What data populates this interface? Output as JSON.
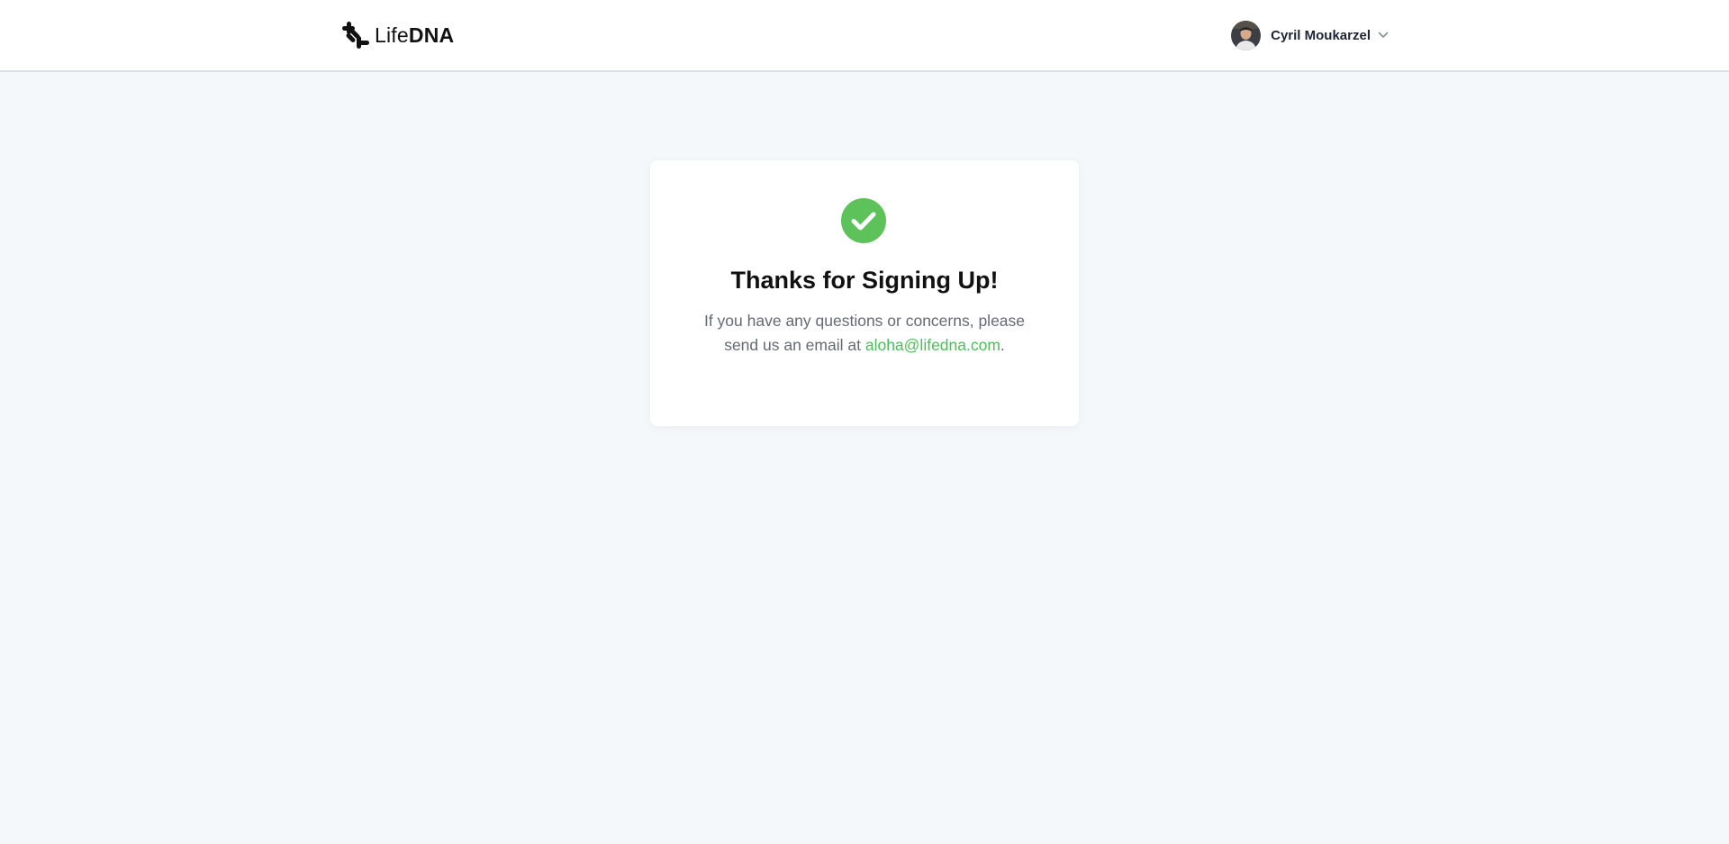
{
  "brand": {
    "name_light": "Life",
    "name_bold": "DNA",
    "accent_color": "#4cbe5a"
  },
  "user": {
    "name": "Cyril Moukarzel",
    "avatar_icon": "user-avatar",
    "menu_icon": "chevron-down-icon"
  },
  "confirmation": {
    "icon": "check-circle-icon",
    "title": "Thanks for Signing Up!",
    "message_line1": "If you have any questions or concerns, please",
    "message_line2_prefix": "send us an email at",
    "email": "aloha@lifedna.com",
    "message_suffix": "."
  }
}
